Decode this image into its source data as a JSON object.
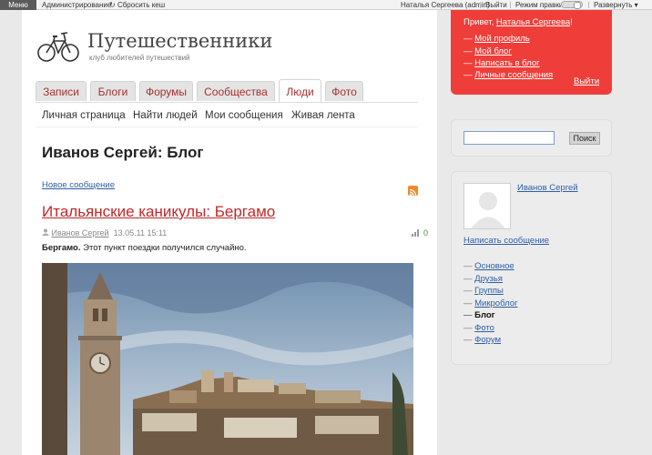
{
  "adminbar": {
    "menu": "Меню",
    "admin": "Администрирование",
    "reset_cache": "Сбросить кеш",
    "user": "Наталья Сергеева (admin)",
    "logout": "Выйти",
    "edit_mode": "Режим правки",
    "expand": "Развернуть"
  },
  "site": {
    "title": "Путешественники",
    "subtitle": "клуб любителей путешествий"
  },
  "tabs": [
    {
      "label": "Записи"
    },
    {
      "label": "Блоги"
    },
    {
      "label": "Форумы"
    },
    {
      "label": "Сообщества"
    },
    {
      "label": "Люди"
    },
    {
      "label": "Фото"
    }
  ],
  "subnav": [
    {
      "label": "Личная страница"
    },
    {
      "label": "Найти людей"
    },
    {
      "label": "Мои сообщения"
    },
    {
      "label": "Живая лента"
    }
  ],
  "page": {
    "title": "Иванов Сергей: Блог",
    "new_post": "Новое сообщение"
  },
  "post": {
    "title": "Итальянские каникулы: Бергамо",
    "author": "Иванов Сергей",
    "date": "13.05.11 15:11",
    "rating": "0",
    "lead": "Бергамо.",
    "text": " Этот пункт поездки получился случайно."
  },
  "userbox": {
    "greeting": "Привет, ",
    "name": "Наталья Сергеева",
    "excl": "!",
    "links": [
      {
        "label": "Мой профиль"
      },
      {
        "label": "Мой блог"
      },
      {
        "label": "Написать в блог"
      },
      {
        "label": "Личные сообщения"
      }
    ],
    "logout": "Выйти"
  },
  "search": {
    "button": "Поиск",
    "value": ""
  },
  "profile": {
    "name": "Иванов Сергей",
    "write": "Написать сообщение",
    "links": [
      {
        "label": "Основное"
      },
      {
        "label": "Друзья"
      },
      {
        "label": "Группы"
      },
      {
        "label": "Микроблог"
      },
      {
        "label": "Блог"
      },
      {
        "label": "Фото"
      },
      {
        "label": "Форум"
      }
    ]
  },
  "colors": {
    "accent_red": "#ef3e3a",
    "link_blue": "#2d5fa6",
    "tab_text": "#a8312d"
  }
}
